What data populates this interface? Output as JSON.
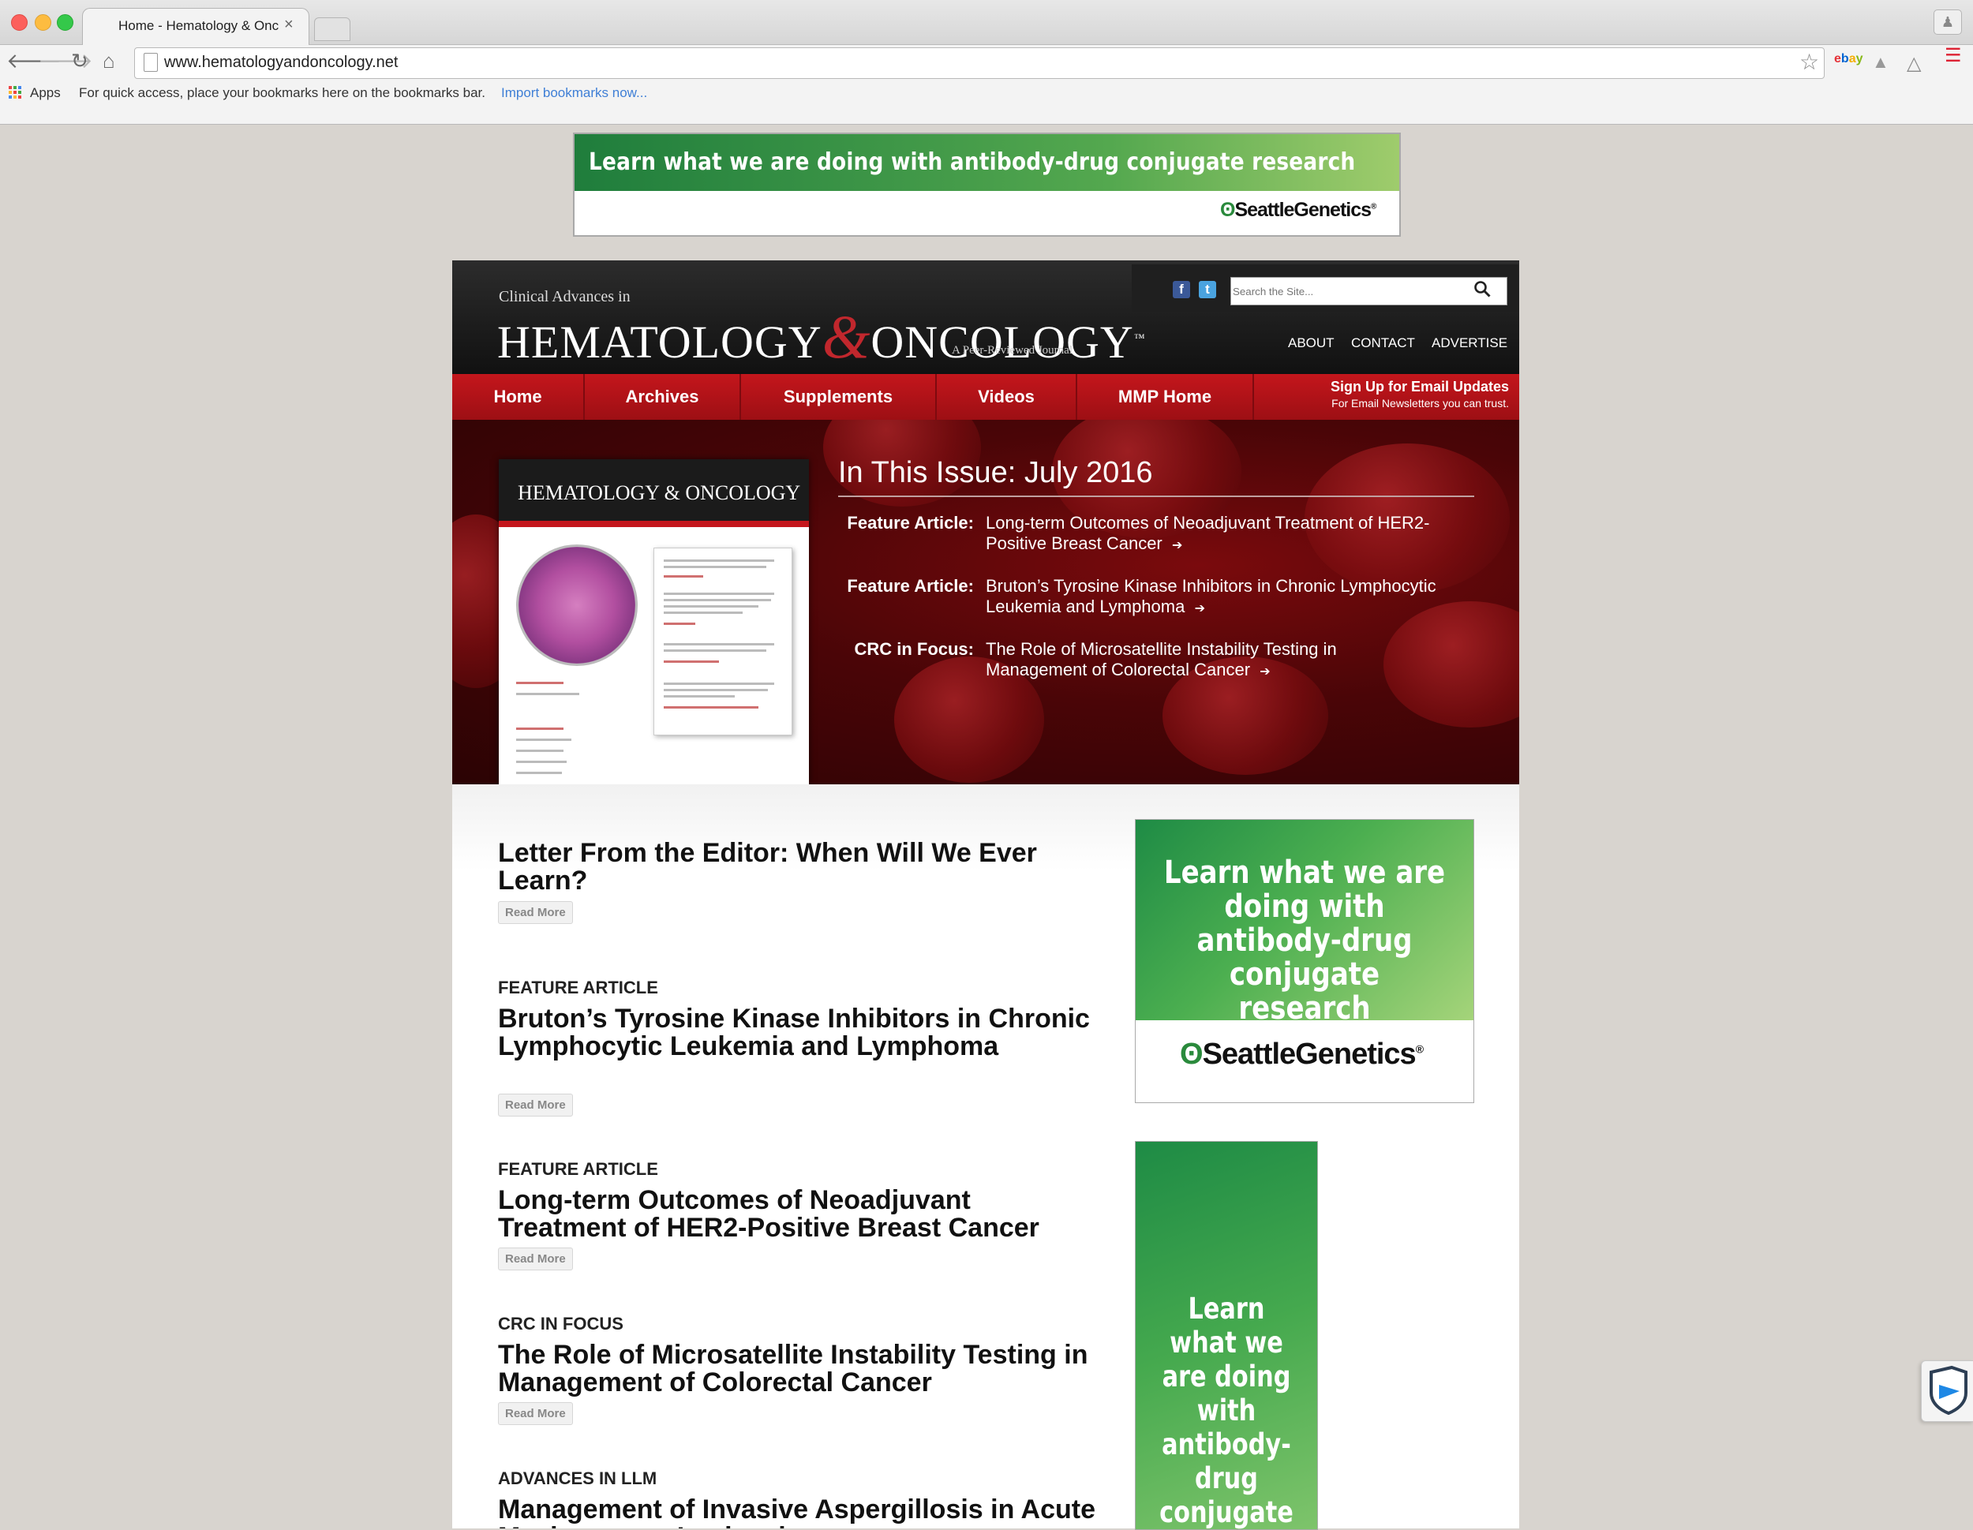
{
  "browser": {
    "tab_title": "Home - Hematology & Onc",
    "tab_close": "×",
    "url": "www.hematologyandoncology.net",
    "bookmarks": {
      "apps_label": "Apps",
      "hint": "For quick access, place your bookmarks here on the bookmarks bar.",
      "import_link": "Import bookmarks now..."
    },
    "extensions": [
      "ebay"
    ]
  },
  "top_ad": {
    "headline": "Learn what we are doing with antibody-drug conjugate research",
    "brand": "SeattleGenetics"
  },
  "header": {
    "brand_small": "Clinical Advances in",
    "brand_word1": "HEMATOLOGY",
    "brand_amp": "&",
    "brand_word2": "ONCOLOGY",
    "brand_tm": "™",
    "brand_tagline": "A Peer-Reviewed Journal",
    "search_placeholder": "Search the Site...",
    "social": {
      "facebook": "f",
      "twitter": "t"
    },
    "links": [
      "ABOUT",
      "CONTACT",
      "ADVERTISE"
    ]
  },
  "nav": {
    "items": [
      "Home",
      "Archives",
      "Supplements",
      "Videos",
      "MMP Home"
    ],
    "signup_title": "Sign Up for Email Updates",
    "signup_sub": "For Email Newsletters you can trust."
  },
  "hero": {
    "cover_title": "HEMATOLOGY & ONCOLOGY",
    "issue_title": "In This Issue: July 2016",
    "features": [
      {
        "label": "Feature Article:",
        "title": "Long-term Outcomes of Neoadjuvant Treatment of HER2-Positive Breast Cancer",
        "arrow": "➔"
      },
      {
        "label": "Feature Article:",
        "title": "Bruton’s Tyrosine Kinase Inhibitors in Chronic Lymphocytic Leukemia and Lymphoma",
        "arrow": "➔"
      },
      {
        "label": "CRC in Focus:",
        "title": "The Role of Microsatellite Instability Testing in Management of Colorectal Cancer",
        "arrow": "➔"
      }
    ]
  },
  "articles": [
    {
      "kicker": "",
      "title": "Letter From the Editor: When Will We Ever Learn?",
      "read_more": "Read More"
    },
    {
      "kicker": "FEATURE ARTICLE",
      "title": "Bruton’s Tyrosine Kinase Inhibitors in Chronic Lymphocytic Leukemia and Lymphoma",
      "read_more": "Read More"
    },
    {
      "kicker": "FEATURE ARTICLE",
      "title": "Long-term Outcomes of Neoadjuvant Treatment of HER2-Positive Breast Cancer",
      "read_more": "Read More"
    },
    {
      "kicker": "CRC IN FOCUS",
      "title": "The Role of Microsatellite Instability Testing in Management of Colorectal Cancer",
      "read_more": "Read More"
    },
    {
      "kicker": "ADVANCES IN LLM",
      "title": "Management of Invasive Aspergillosis in Acute Myelogenous Leukemia"
    }
  ],
  "side_ad": {
    "headline": "Learn what we are doing with antibody-drug conjugate research",
    "brand": "SeattleGenetics"
  },
  "tall_ad": {
    "headline": "Learn what we are doing with antibody-drug conjugate"
  },
  "colors": {
    "brand_red": "#c4161c",
    "ad_green": "#4caf50",
    "header_dark": "#1b1b1b"
  }
}
